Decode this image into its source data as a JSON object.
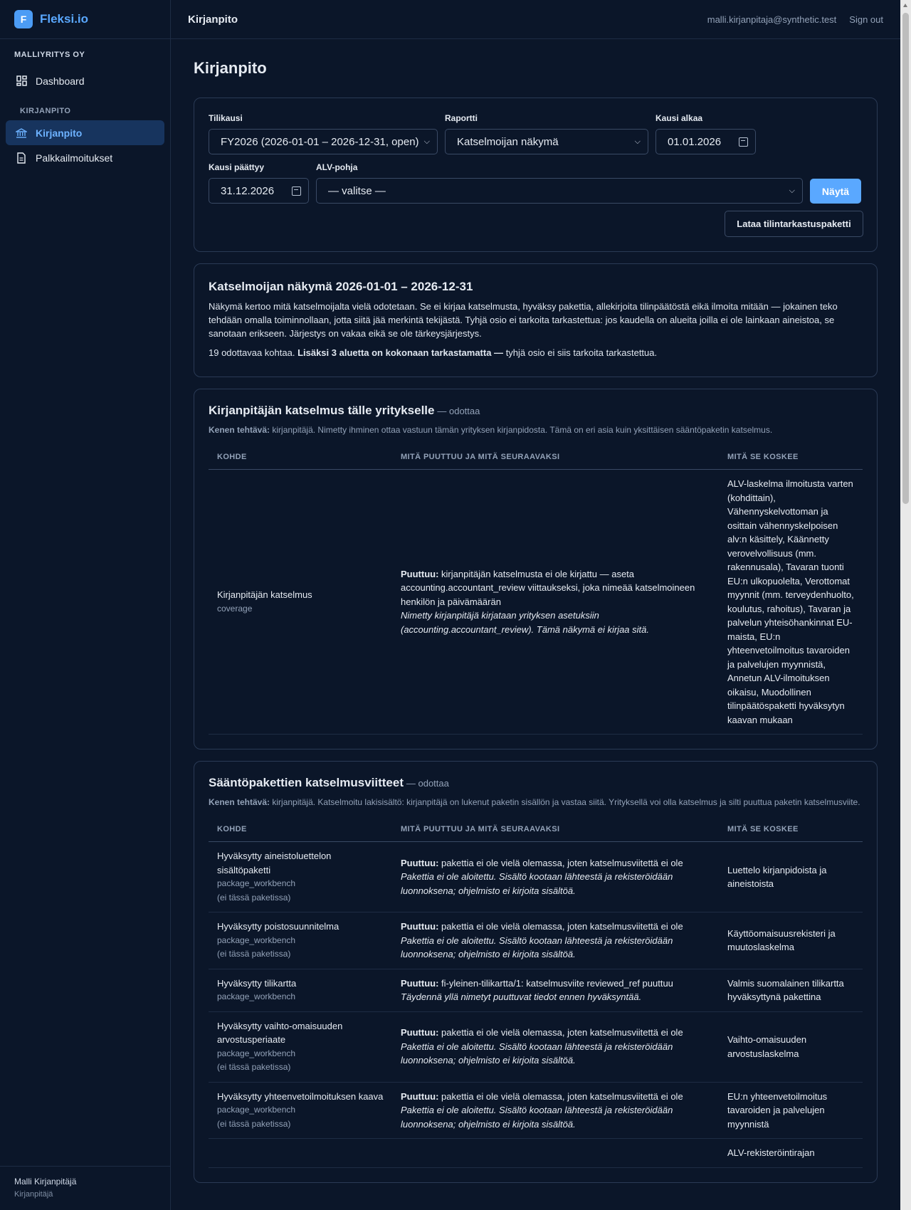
{
  "app": {
    "logo_letter": "F",
    "name": "Fleksi.io",
    "company": "MALLIYRITYS OY"
  },
  "sidebar": {
    "items": [
      {
        "label": "Dashboard",
        "icon": "dashboard-icon"
      },
      {
        "label": "Kirjanpito",
        "icon": "bank-icon"
      },
      {
        "label": "Palkkailmoitukset",
        "icon": "document-icon"
      }
    ],
    "section_label": "KIRJANPITO",
    "user": {
      "name": "Malli Kirjanpitäjä",
      "role": "Kirjanpitäjä"
    }
  },
  "topbar": {
    "title": "Kirjanpito",
    "email": "malli.kirjanpitaja@synthetic.test",
    "sign_out": "Sign out"
  },
  "page": {
    "title": "Kirjanpito"
  },
  "filters": {
    "tilikausi_label": "Tilikausi",
    "tilikausi_value": "FY2026 (2026-01-01 – 2026-12-31, open)",
    "raportti_label": "Raportti",
    "raportti_value": "Katselmoijan näkymä",
    "alkaa_label": "Kausi alkaa",
    "alkaa_value": "01.01.2026",
    "paattyy_label": "Kausi päättyy",
    "paattyy_value": "31.12.2026",
    "alv_label": "ALV-pohja",
    "alv_value": "— valitse —",
    "show_button": "Näytä",
    "download_button": "Lataa tilintarkastuspaketti"
  },
  "intro": {
    "title": "Katselmoijan näkymä 2026-01-01 – 2026-12-31",
    "description": "Näkymä kertoo mitä katselmoijalta vielä odotetaan. Se ei kirjaa katselmusta, hyväksy pakettia, allekirjoita tilinpäätöstä eikä ilmoita mitään — jokainen teko tehdään omalla toiminnollaan, jotta siitä jää merkintä tekijästä. Tyhjä osio ei tarkoita tarkastettua: jos kaudella on alueita joilla ei ole lainkaan aineistoa, se sanotaan erikseen. Järjestys on vakaa eikä se ole tärkeysjärjestys.",
    "count_text": "19 odottavaa kohtaa.",
    "count_bold": "Lisäksi 3 aluetta on kokonaan tarkastamatta —",
    "count_tail": "tyhjä osio ei siis tarkoita tarkastettua."
  },
  "columns": {
    "kohde": "KOHDE",
    "puuttuu": "MITÄ PUUTTUU JA MITÄ SEURAAVAKSI",
    "koskee": "MITÄ SE KOSKEE"
  },
  "accountant_review": {
    "title": "Kirjanpitäjän katselmus tälle yritykselle",
    "status": "— odottaa",
    "who_label": "Kenen tehtävä:",
    "who_text": "kirjanpitäjä. Nimetty ihminen ottaa vastuun tämän yrityksen kirjanpidosta. Tämä on eri asia kuin yksittäisen sääntöpaketin katselmus.",
    "row": {
      "kohde": "Kirjanpitäjän katselmus",
      "kohde_sub": "coverage",
      "missing_label": "Puuttuu:",
      "missing_text": "kirjanpitäjän katselmusta ei ole kirjattu — aseta accounting.accountant_review viittaukseksi, joka nimeää katselmoineen henkilön ja päivämäärän",
      "hint": "Nimetty kirjanpitäjä kirjataan yrityksen asetuksiin (accounting.accountant_review). Tämä näkymä ei kirjaa sitä.",
      "koskee": "ALV-laskelma ilmoitusta varten (kohdittain), Vähennyskelvottoman ja osittain vähennyskelpoisen alv:n käsittely, Käännetty verovelvollisuus (mm. rakennusala), Tavaran tuonti EU:n ulkopuolelta, Verottomat myynnit (mm. terveydenhuolto, koulutus, rahoitus), Tavaran ja palvelun yhteisöhankinnat EU-maista, EU:n yhteenvetoilmoitus tavaroiden ja palvelujen myynnistä, Annetun ALV-ilmoituksen oikaisu, Muodollinen tilinpäätöspaketti hyväksytyn kaavan mukaan"
    }
  },
  "package_review": {
    "title": "Sääntöpakettien katselmusviitteet",
    "status": "— odottaa",
    "who_label": "Kenen tehtävä:",
    "who_text": "kirjanpitäjä. Katselmoitu lakisisältö: kirjanpitäjä on lukenut paketin sisällön ja vastaa siitä. Yrityksellä voi olla katselmus ja silti puuttua paketin katselmusviite.",
    "rows": [
      {
        "kohde": "Hyväksytty aineistoluettelon sisältöpaketti",
        "sub1": "package_workbench",
        "sub2": "(ei tässä paketissa)",
        "missing_label": "Puuttuu:",
        "missing_text": "pakettia ei ole vielä olemassa, joten katselmusviitettä ei ole",
        "hint": "Pakettia ei ole aloitettu. Sisältö kootaan lähteestä ja rekisteröidään luonnoksena; ohjelmisto ei kirjoita sisältöä.",
        "koskee": "Luettelo kirjanpidoista ja aineistoista"
      },
      {
        "kohde": "Hyväksytty poistosuunnitelma",
        "sub1": "package_workbench",
        "sub2": "(ei tässä paketissa)",
        "missing_label": "Puuttuu:",
        "missing_text": "pakettia ei ole vielä olemassa, joten katselmusviitettä ei ole",
        "hint": "Pakettia ei ole aloitettu. Sisältö kootaan lähteestä ja rekisteröidään luonnoksena; ohjelmisto ei kirjoita sisältöä.",
        "koskee": "Käyttöomaisuusrekisteri ja muutoslaskelma"
      },
      {
        "kohde": "Hyväksytty tilikartta",
        "sub1": "package_workbench",
        "sub2": "",
        "missing_label": "Puuttuu:",
        "missing_text": "fi-yleinen-tilikartta/1: katselmusviite reviewed_ref puuttuu",
        "hint": "Täydennä yllä nimetyt puuttuvat tiedot ennen hyväksyntää.",
        "koskee": "Valmis suomalainen tilikartta hyväksyttynä pakettina"
      },
      {
        "kohde": "Hyväksytty vaihto-omaisuuden arvostusperiaate",
        "sub1": "package_workbench",
        "sub2": "(ei tässä paketissa)",
        "missing_label": "Puuttuu:",
        "missing_text": "pakettia ei ole vielä olemassa, joten katselmusviitettä ei ole",
        "hint": "Pakettia ei ole aloitettu. Sisältö kootaan lähteestä ja rekisteröidään luonnoksena; ohjelmisto ei kirjoita sisältöä.",
        "koskee": "Vaihto-omaisuuden arvostuslaskelma"
      },
      {
        "kohde": "Hyväksytty yhteenvetoilmoituksen kaava",
        "sub1": "package_workbench",
        "sub2": "(ei tässä paketissa)",
        "missing_label": "Puuttuu:",
        "missing_text": "pakettia ei ole vielä olemassa, joten katselmusviitettä ei ole",
        "hint": "Pakettia ei ole aloitettu. Sisältö kootaan lähteestä ja rekisteröidään luonnoksena; ohjelmisto ei kirjoita sisältöä.",
        "koskee": "EU:n yhteenvetoilmoitus tavaroiden ja palvelujen myynnistä"
      },
      {
        "kohde": "",
        "sub1": "",
        "sub2": "",
        "missing_label": "",
        "missing_text": "",
        "hint": "",
        "koskee": "ALV-rekisteröintirajan"
      }
    ]
  }
}
